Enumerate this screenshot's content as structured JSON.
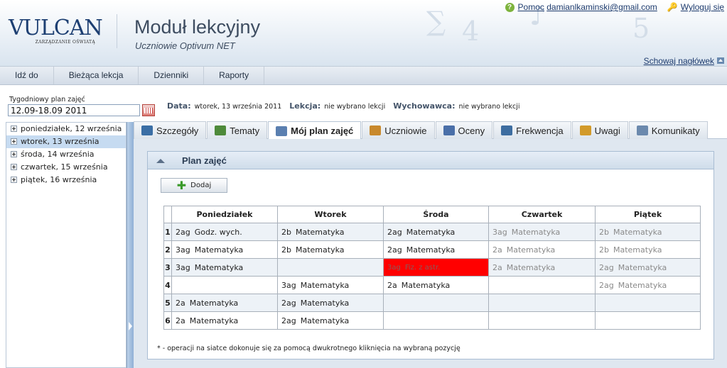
{
  "header": {
    "logo_text": "VULCAN",
    "logo_subtitle": "ZARZĄDZANIE OŚWIATĄ",
    "app_title": "Moduł lekcyjny",
    "app_subtitle": "Uczniowie Optivum NET",
    "help_label": "Pomoc",
    "user_email": "damianlkaminski@gmail.com",
    "logout_label": "Wyloguj się",
    "hide_header_label": "Schowaj nagłówek"
  },
  "menu": {
    "items": [
      {
        "label": "Idź do"
      },
      {
        "label": "Bieżąca lekcja"
      },
      {
        "label": "Dzienniki"
      },
      {
        "label": "Raporty"
      }
    ]
  },
  "week": {
    "label": "Tygodniowy plan zajęć",
    "value": "12.09-18.09 2011"
  },
  "info": {
    "date_label": "Data:",
    "date_value": "wtorek, 13 września 2011",
    "lesson_label": "Lekcja:",
    "lesson_value": "nie wybrano lekcji",
    "tutor_label": "Wychowawca:",
    "tutor_value": "nie wybrano lekcji"
  },
  "days": [
    {
      "label": "poniedziałek, 12 września",
      "selected": false
    },
    {
      "label": "wtorek, 13 września",
      "selected": true
    },
    {
      "label": "środa, 14 września",
      "selected": false
    },
    {
      "label": "czwartek, 15 września",
      "selected": false
    },
    {
      "label": "piątek, 16 września",
      "selected": false
    }
  ],
  "tabs": [
    {
      "label": "Szczegóły",
      "icon": "magnifier-icon",
      "color": "#3a6ea5"
    },
    {
      "label": "Tematy",
      "icon": "board-icon",
      "color": "#4e8a3a"
    },
    {
      "label": "Mój plan zajęć",
      "icon": "grid-icon",
      "color": "#5a7fb0",
      "active": true
    },
    {
      "label": "Uczniowie",
      "icon": "students-icon",
      "color": "#c8892c"
    },
    {
      "label": "Oceny",
      "icon": "grades-icon",
      "color": "#4a6fa8"
    },
    {
      "label": "Frekwencja",
      "icon": "attendance-icon",
      "color": "#3d6da0"
    },
    {
      "label": "Uwagi",
      "icon": "notes-icon",
      "color": "#d29a2a"
    },
    {
      "label": "Komunikaty",
      "icon": "megaphone-icon",
      "color": "#6b89ad"
    }
  ],
  "plan": {
    "title": "Plan zajęć",
    "add_label": "Dodaj",
    "headers": [
      "Poniedziałek",
      "Wtorek",
      "Środa",
      "Czwartek",
      "Piątek"
    ],
    "rows": [
      {
        "num": "1",
        "cells": [
          {
            "cls": "2ag",
            "subj": "Godz. wych.",
            "style": ""
          },
          {
            "cls": "2b",
            "subj": "Matematyka",
            "style": ""
          },
          {
            "cls": "2ag",
            "subj": "Matematyka",
            "style": ""
          },
          {
            "cls": "3ag",
            "subj": "Matematyka",
            "style": "gray"
          },
          {
            "cls": "2b",
            "subj": "Matematyka",
            "style": "gray"
          }
        ]
      },
      {
        "num": "2",
        "cells": [
          {
            "cls": "3ag",
            "subj": "Matematyka",
            "style": ""
          },
          {
            "cls": "2b",
            "subj": "Matematyka",
            "style": ""
          },
          {
            "cls": "2ag",
            "subj": "Matematyka",
            "style": ""
          },
          {
            "cls": "2a",
            "subj": "Matematyka",
            "style": "gray"
          },
          {
            "cls": "2b",
            "subj": "Matematyka",
            "style": "gray"
          }
        ]
      },
      {
        "num": "3",
        "cells": [
          {
            "cls": "3ag",
            "subj": "Matematyka",
            "style": ""
          },
          {
            "cls": "",
            "subj": "",
            "style": ""
          },
          {
            "cls": "3ag",
            "subj": "Fiz. z astr.",
            "style": "red"
          },
          {
            "cls": "2a",
            "subj": "Matematyka",
            "style": "gray"
          },
          {
            "cls": "2ag",
            "subj": "Matematyka",
            "style": "gray"
          }
        ]
      },
      {
        "num": "4",
        "cells": [
          {
            "cls": "",
            "subj": "",
            "style": ""
          },
          {
            "cls": "3ag",
            "subj": "Matematyka",
            "style": ""
          },
          {
            "cls": "2a",
            "subj": "Matematyka",
            "style": ""
          },
          {
            "cls": "",
            "subj": "",
            "style": ""
          },
          {
            "cls": "2ag",
            "subj": "Matematyka",
            "style": "gray"
          }
        ]
      },
      {
        "num": "5",
        "cells": [
          {
            "cls": "2a",
            "subj": "Matematyka",
            "style": ""
          },
          {
            "cls": "2ag",
            "subj": "Matematyka",
            "style": ""
          },
          {
            "cls": "",
            "subj": "",
            "style": ""
          },
          {
            "cls": "",
            "subj": "",
            "style": ""
          },
          {
            "cls": "",
            "subj": "",
            "style": ""
          }
        ]
      },
      {
        "num": "6",
        "cells": [
          {
            "cls": "2a",
            "subj": "Matematyka",
            "style": ""
          },
          {
            "cls": "2ag",
            "subj": "Matematyka",
            "style": ""
          },
          {
            "cls": "",
            "subj": "",
            "style": ""
          },
          {
            "cls": "",
            "subj": "",
            "style": ""
          },
          {
            "cls": "",
            "subj": "",
            "style": ""
          }
        ]
      }
    ],
    "footnote": "* - operacji na siatce dokonuje się za pomocą dwukrotnego kliknięcia na wybraną pozycję"
  }
}
